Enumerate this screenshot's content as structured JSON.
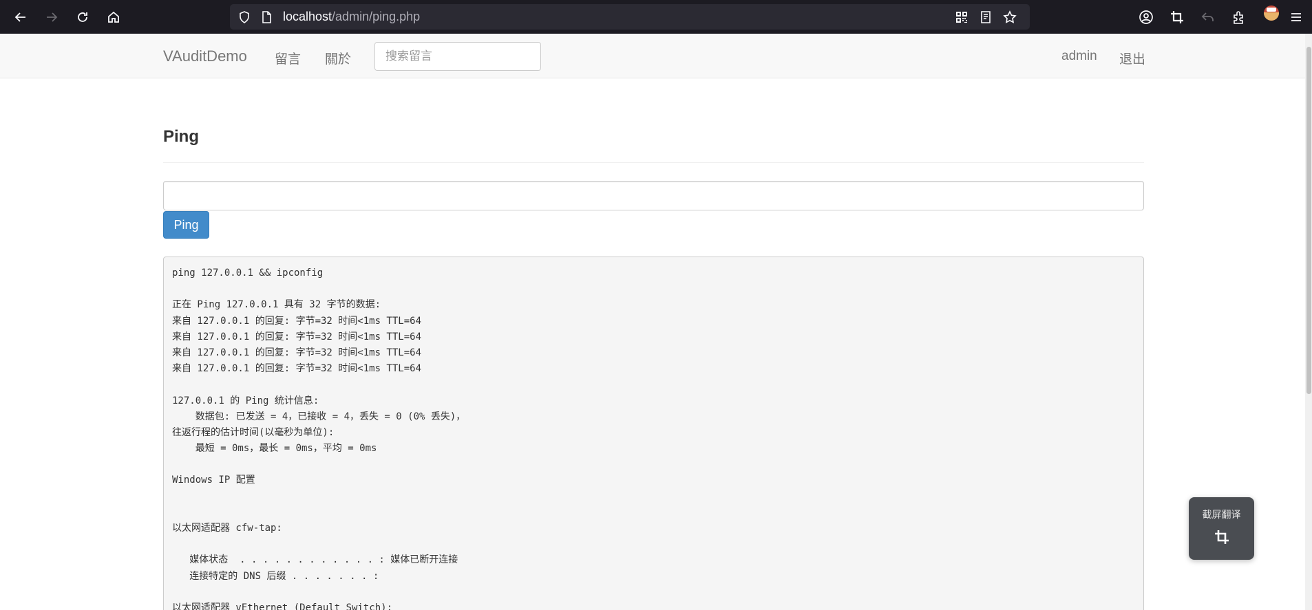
{
  "browser": {
    "url_host": "localhost",
    "url_path": "/admin/ping.php"
  },
  "navbar": {
    "brand": "VAuditDemo",
    "links": [
      "留言",
      "關於"
    ],
    "search_placeholder": "搜索留言",
    "user": "admin",
    "logout": "退出"
  },
  "main": {
    "title": "Ping",
    "input_value": "",
    "button_label": "Ping",
    "output_lines": [
      "ping 127.0.0.1 && ipconfig",
      "",
      "正在 Ping 127.0.0.1 具有 32 字节的数据:",
      "来自 127.0.0.1 的回复: 字节=32 时间<1ms TTL=64",
      "来自 127.0.0.1 的回复: 字节=32 时间<1ms TTL=64",
      "来自 127.0.0.1 的回复: 字节=32 时间<1ms TTL=64",
      "来自 127.0.0.1 的回复: 字节=32 时间<1ms TTL=64",
      "",
      "127.0.0.1 的 Ping 统计信息:",
      "    数据包: 已发送 = 4，已接收 = 4，丢失 = 0 (0% 丢失)，",
      "往返行程的估计时间(以毫秒为单位):",
      "    最短 = 0ms，最长 = 0ms，平均 = 0ms",
      "",
      "Windows IP 配置",
      "",
      "",
      "以太网适配器 cfw-tap:",
      "",
      "   媒体状态  . . . . . . . . . . . . : 媒体已断开连接",
      "   连接特定的 DNS 后缀 . . . . . . . :",
      "",
      "以太网适配器 vEthernet (Default Switch):"
    ]
  },
  "float_widget": {
    "label": "截屏翻译",
    "icon": "crop-icon"
  },
  "colors": {
    "chrome_bg": "#1c1b22",
    "urlbar_bg": "#2b2a33",
    "navbar_bg": "#f8f8f8",
    "primary": "#428bca",
    "output_bg": "#f5f5f5"
  }
}
